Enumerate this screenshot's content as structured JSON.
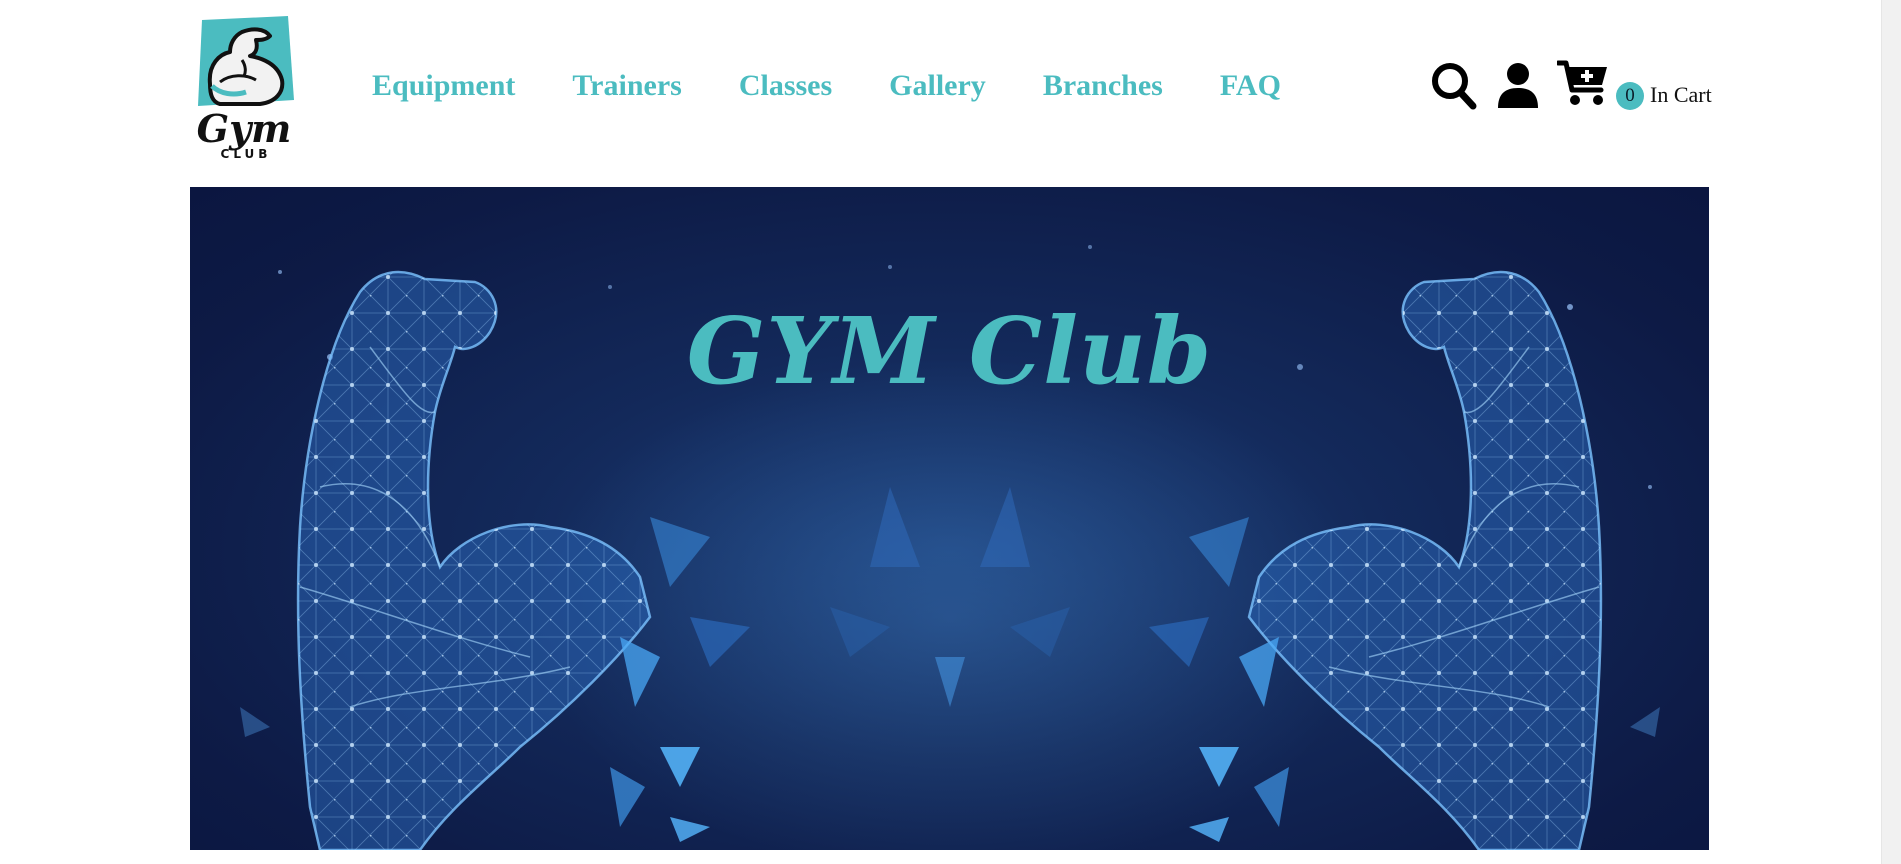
{
  "brand": {
    "logo_icon": "flexed-arm-logo",
    "logo_text": "Gym",
    "logo_subtext": "CLUB",
    "accent_color": "#4bbcc0"
  },
  "nav": {
    "items": [
      {
        "label": "Equipment"
      },
      {
        "label": "Trainers"
      },
      {
        "label": "Classes"
      },
      {
        "label": "Gallery"
      },
      {
        "label": "Branches"
      },
      {
        "label": "FAQ"
      }
    ]
  },
  "header_actions": {
    "search_icon": "search-icon",
    "user_icon": "user-icon",
    "cart_icon": "cart-plus-icon",
    "cart_count": "0",
    "cart_label": "In Cart"
  },
  "hero": {
    "title": "GYM Club",
    "background_color": "#0d1a45",
    "artwork": "polygonal-flexed-arms"
  }
}
